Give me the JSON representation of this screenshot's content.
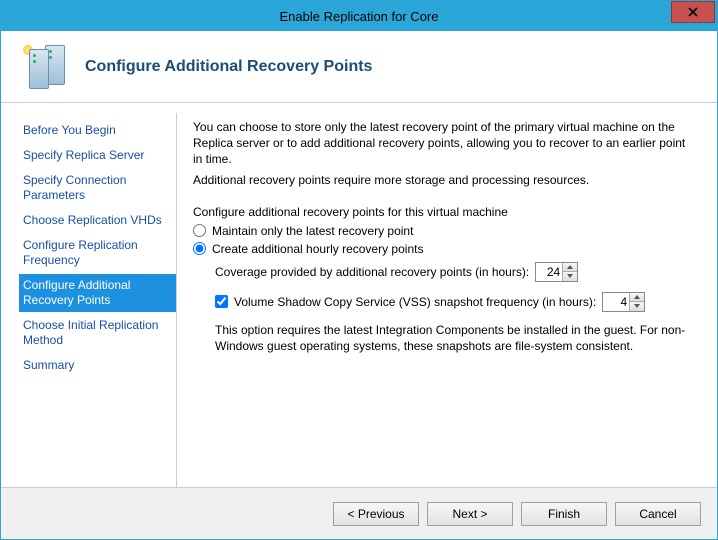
{
  "window": {
    "title": "Enable Replication for Core"
  },
  "header": {
    "title": "Configure Additional Recovery Points"
  },
  "sidebar": {
    "steps": [
      "Before You Begin",
      "Specify Replica Server",
      "Specify Connection Parameters",
      "Choose Replication VHDs",
      "Configure Replication Frequency",
      "Configure Additional Recovery Points",
      "Choose Initial Replication Method",
      "Summary"
    ],
    "activeIndex": 5
  },
  "content": {
    "intro1": "You can choose to store only the latest recovery point of the primary virtual machine on the Replica server or to add additional recovery points, allowing you to recover to an earlier point in time.",
    "intro2": "Additional recovery points require more storage and processing resources.",
    "subhead": "Configure additional recovery points for this virtual machine",
    "radioLatest": "Maintain only the latest recovery point",
    "radioCreate": "Create additional hourly recovery points",
    "coverageLabel": "Coverage provided by additional recovery points (in hours):",
    "coverageValue": "24",
    "vssLabel": "Volume Shadow Copy Service (VSS) snapshot frequency (in hours):",
    "vssValue": "4",
    "vssChecked": true,
    "note": "This option requires the latest Integration Components be installed in the guest. For non-Windows guest operating systems, these snapshots are file-system consistent."
  },
  "footer": {
    "previous": "< Previous",
    "next": "Next >",
    "finish": "Finish",
    "cancel": "Cancel"
  }
}
